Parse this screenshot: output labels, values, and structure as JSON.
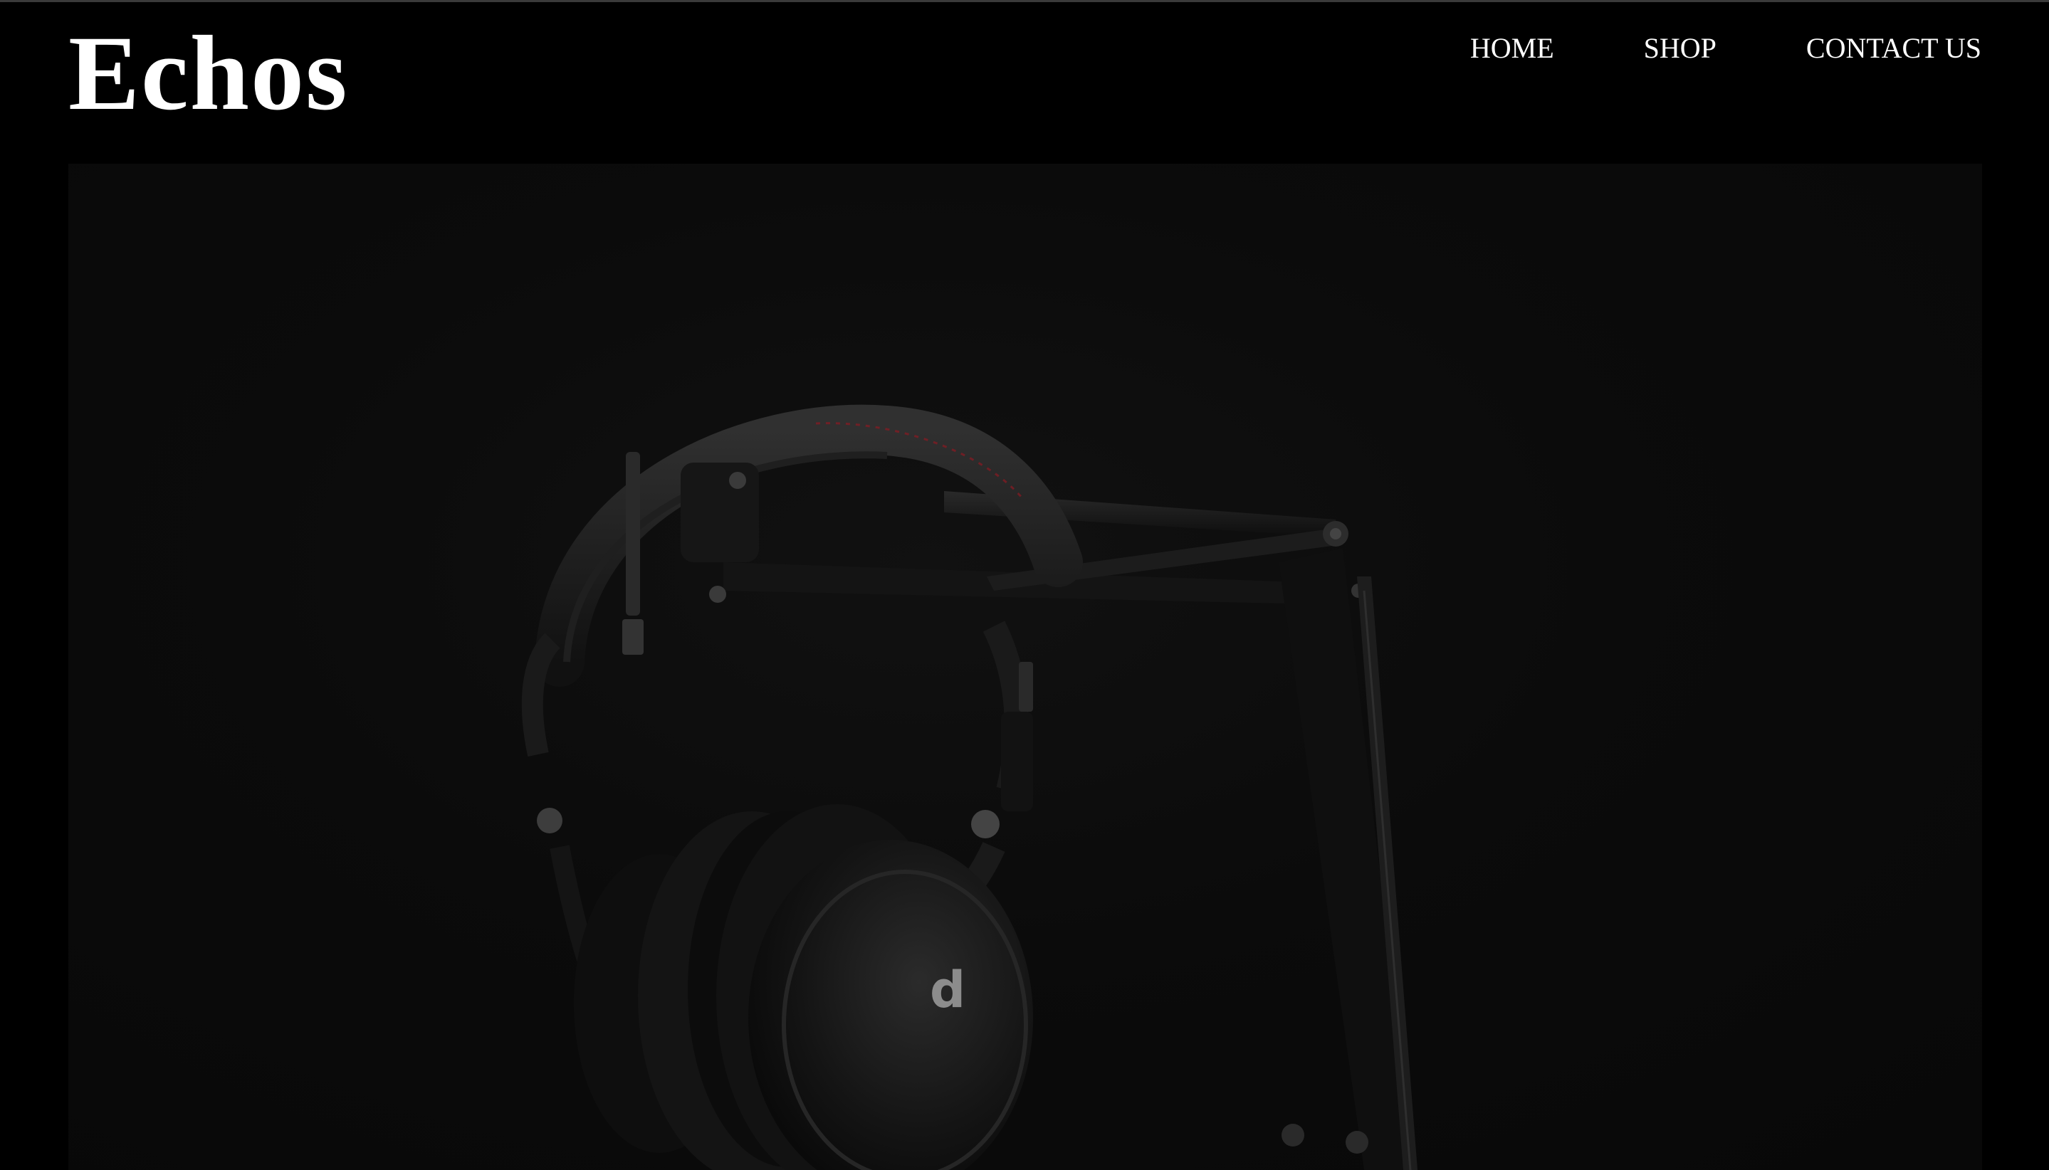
{
  "brand": {
    "name": "Echos"
  },
  "nav": {
    "items": [
      {
        "label": "HOME"
      },
      {
        "label": "SHOP"
      },
      {
        "label": "CONTACT US"
      }
    ]
  },
  "hero": {
    "image_subject": "headphones hanging on a microphone boom arm",
    "colors": {
      "background": "#0a0a0a",
      "accent": "#8a1a22"
    }
  }
}
